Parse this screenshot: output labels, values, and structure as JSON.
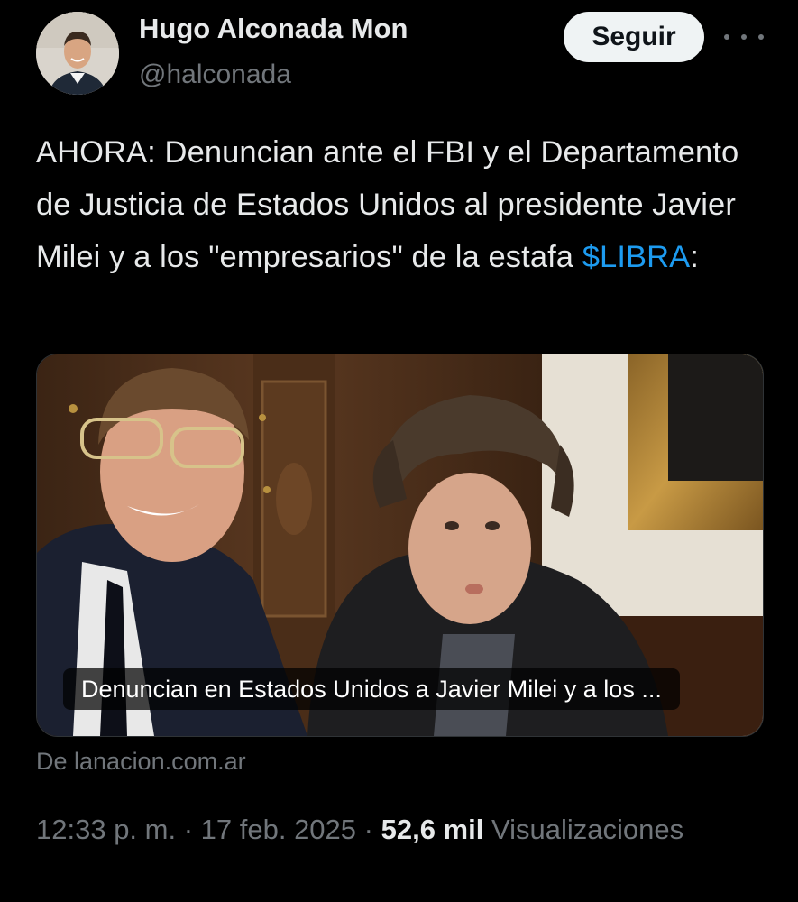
{
  "author": {
    "name": "Hugo Alconada Mon",
    "handle": "@halconada"
  },
  "actions": {
    "follow_label": "Seguir"
  },
  "tweet": {
    "text_before": "AHORA: Denuncian ante el FBI y el Departamento de Justicia de Estados Unidos al presidente Javier Milei y a los \"empresarios\" de la estafa ",
    "cashtag": "$LIBRA",
    "text_after": ":"
  },
  "card": {
    "title": "Denuncian en Estados Unidos a Javier Milei y a los ...",
    "source": "De lanacion.com.ar"
  },
  "meta": {
    "time": "12:33 p. m.",
    "sep1": " · ",
    "date": "17 feb. 2025",
    "sep2": " · ",
    "views_count": "52,6 mil",
    "views_label": " Visualizaciones"
  },
  "colors": {
    "background": "#000000",
    "text": "#e7e9ea",
    "secondary": "#71767b",
    "link": "#1d9bf0",
    "follow_button_bg": "#eff3f4"
  },
  "icons": [
    "more-options-icon"
  ]
}
